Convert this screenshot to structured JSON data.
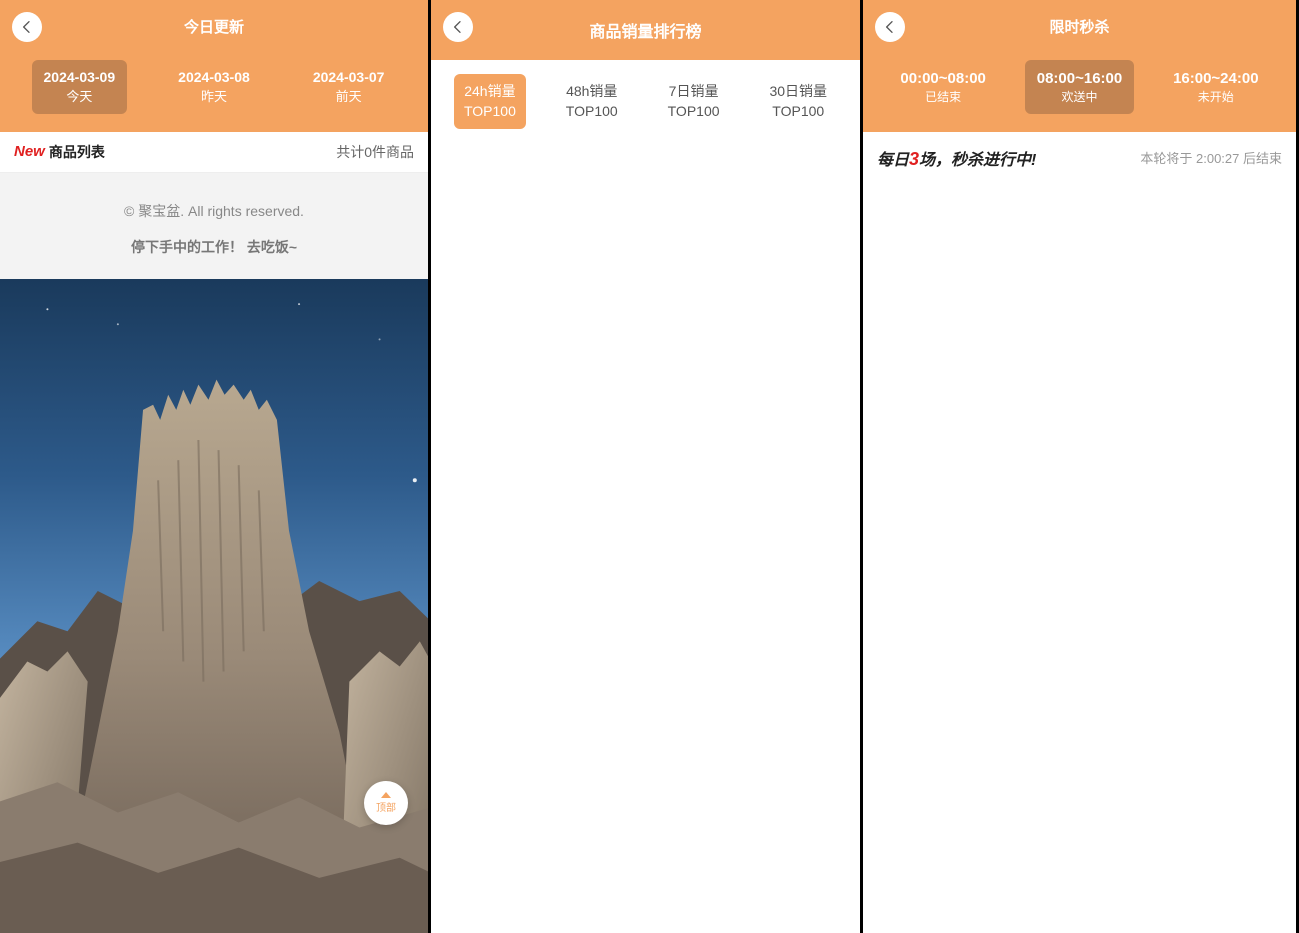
{
  "panel1": {
    "title": "今日更新",
    "tabs": [
      {
        "line1": "2024-03-09",
        "line2": "今天"
      },
      {
        "line1": "2024-03-08",
        "line2": "昨天"
      },
      {
        "line1": "2024-03-07",
        "line2": "前天"
      }
    ],
    "newTag": "New",
    "listLabel": "商品列表",
    "countText": "共计0件商品",
    "footerLine1": "© 聚宝盆. All rights reserved.",
    "footerLine2": "停下手中的工作！ 去吃饭~",
    "topBtn": "顶部"
  },
  "panel2": {
    "title": "商品销量排行榜",
    "tabs": [
      {
        "line1": "24h销量",
        "line2": "TOP100"
      },
      {
        "line1": "48h销量",
        "line2": "TOP100"
      },
      {
        "line1": "7日销量",
        "line2": "TOP100"
      },
      {
        "line1": "30日销量",
        "line2": "TOP100"
      }
    ]
  },
  "panel3": {
    "title": "限时秒杀",
    "tabs": [
      {
        "line1": "00:00~08:00",
        "line2": "已结束"
      },
      {
        "line1": "08:00~16:00",
        "line2": "欢送中"
      },
      {
        "line1": "16:00~24:00",
        "line2": "未开始"
      }
    ],
    "seckillPrefix": "每日",
    "seckillNum": "3",
    "seckillSuffix": "场，秒杀进行中!",
    "countdownText": "本轮将于 2:00:27 后结束"
  }
}
